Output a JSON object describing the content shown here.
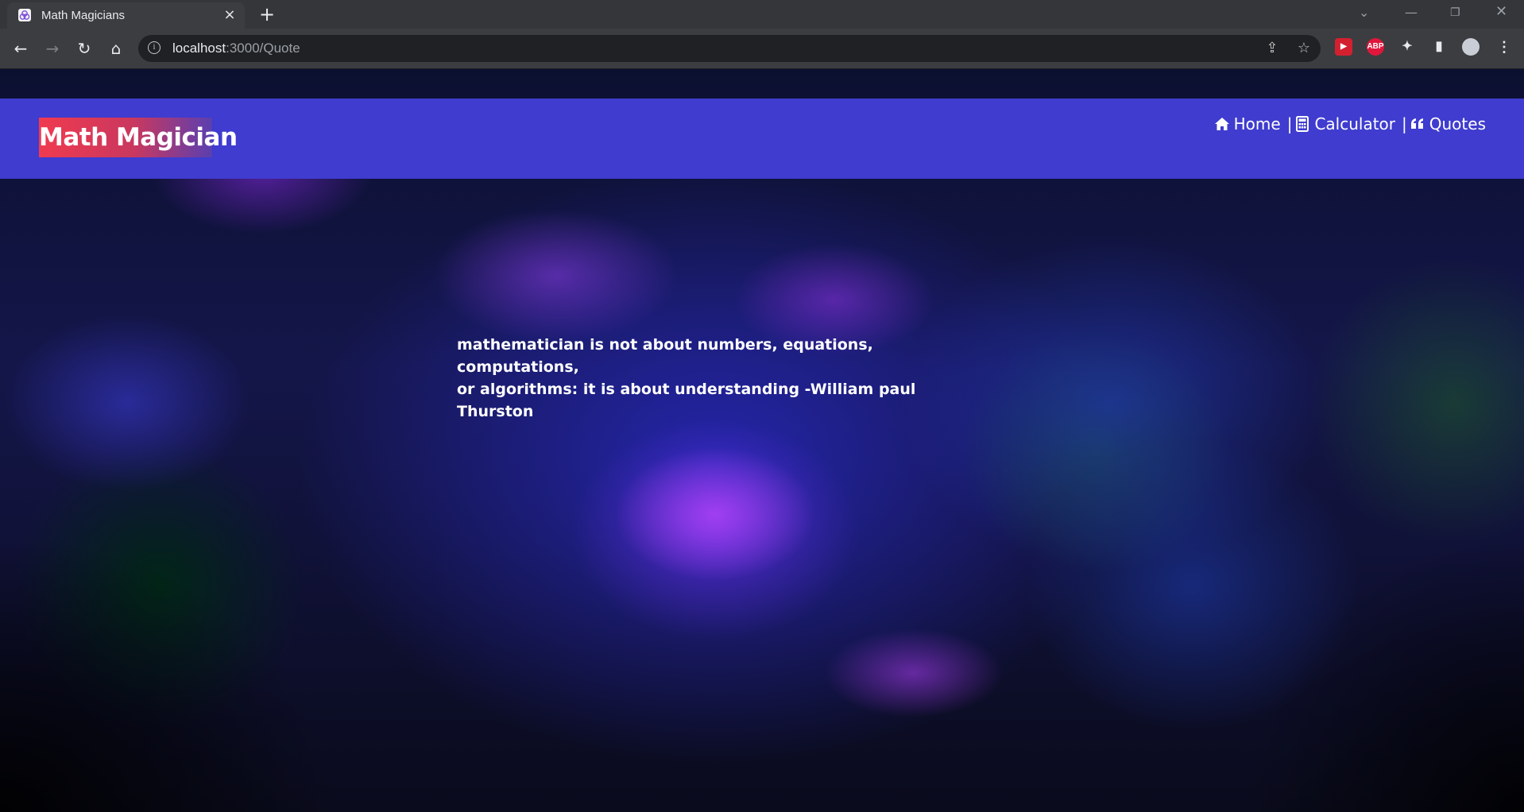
{
  "browser": {
    "tab_title": "Math Magicians",
    "url_host": "localhost",
    "url_path": ":3000/Quote"
  },
  "nav": {
    "logo": "Math Magician",
    "links": [
      {
        "label": "Home",
        "icon": "home-icon"
      },
      {
        "label": "Calculator",
        "icon": "calculator-icon"
      },
      {
        "label": "Quotes",
        "icon": "quote-icon"
      }
    ],
    "separator": "|"
  },
  "quote": {
    "line1": "mathematician is not about numbers, equations, computations,",
    "line2": "or algorithms: it is about understanding -William paul Thurston"
  },
  "colors": {
    "navbar": "#3f3ccf",
    "logo_gradient_start": "#f03a4f",
    "logo_gradient_end": "#5a3fb0",
    "text": "#ffffff"
  }
}
